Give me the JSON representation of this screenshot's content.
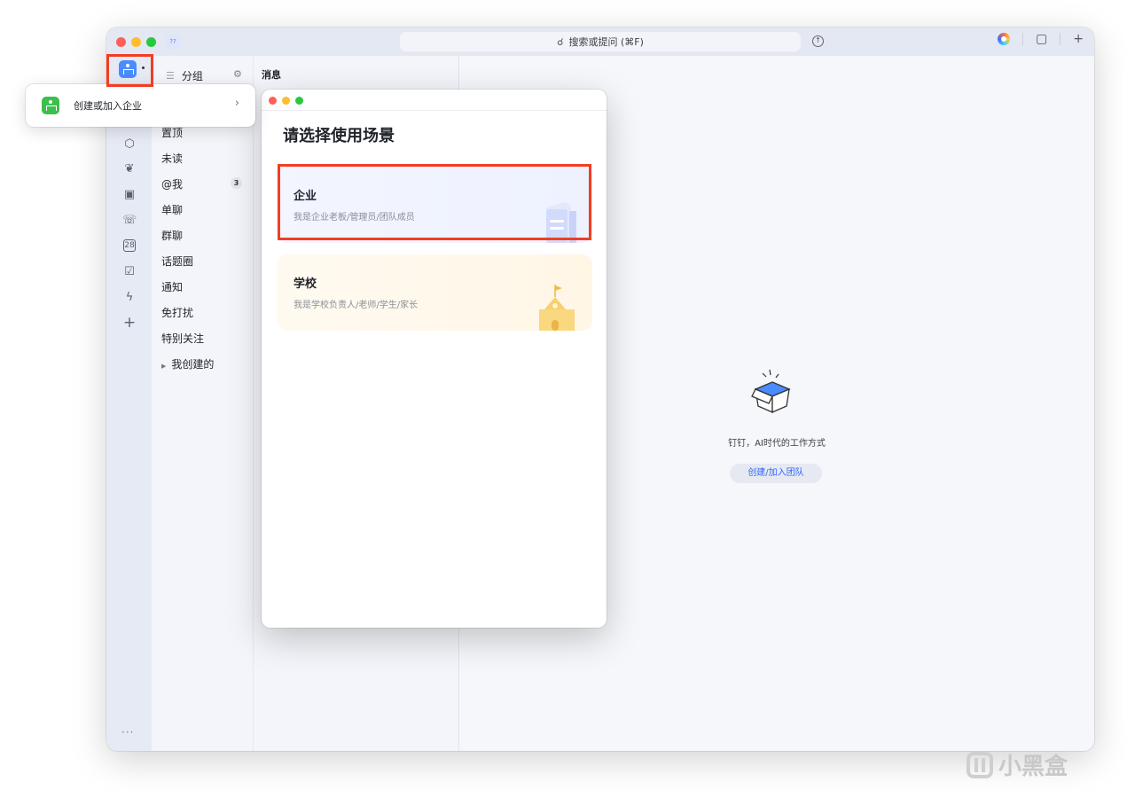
{
  "titlebar": {
    "badge": "??",
    "search_placeholder": "搜索或提问 (⌘F)"
  },
  "rail": {
    "more": "···"
  },
  "org_menu": {
    "label": "创建或加入企业"
  },
  "groups": {
    "header_label": "分组",
    "items": [
      "置顶",
      "未读",
      "@我",
      "单聊",
      "群聊",
      "话题圈",
      "通知",
      "免打扰",
      "特别关注",
      "我创建的"
    ],
    "mention_count": "3"
  },
  "messages": {
    "title": "消息"
  },
  "dialog": {
    "title": "请选择使用场景",
    "cards": [
      {
        "title": "企业",
        "desc": "我是企业老板/管理员/团队成员"
      },
      {
        "title": "学校",
        "desc": "我是学校负责人/老师/学生/家长"
      }
    ]
  },
  "empty_state": {
    "text": "钉钉，AI时代的工作方式",
    "button": "创建/加入团队"
  },
  "watermark": {
    "text": "小黑盒"
  },
  "colors": {
    "highlight_box": "#f23d22",
    "accent_blue": "#3366ff",
    "org_icon_blue": "#4a8cff",
    "org_icon_green": "#3cbf4c"
  }
}
